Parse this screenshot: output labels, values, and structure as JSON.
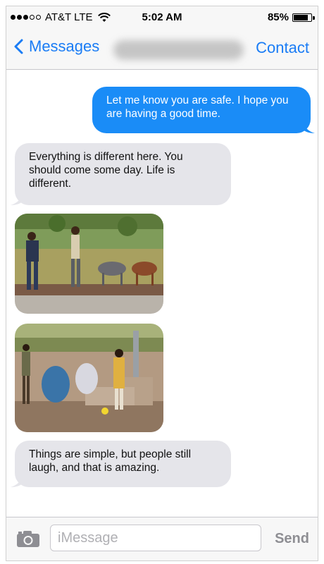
{
  "status_bar": {
    "carrier": "AT&T LTE",
    "time": "5:02 AM",
    "battery_text": "85%",
    "battery_level": 0.85,
    "signal_bars_filled": 3,
    "signal_bars_total": 5
  },
  "nav": {
    "back_label": "Messages",
    "contact_label": "Contact"
  },
  "messages": [
    {
      "direction": "sent",
      "text": "Let me know you are safe. I hope you are having a good time."
    },
    {
      "direction": "received",
      "text": "Everything is different here. You should come some day. Life is different."
    },
    {
      "direction": "received",
      "type": "image",
      "icon": "photo-people-walking-with-cattle"
    },
    {
      "direction": "received",
      "type": "image",
      "icon": "photo-people-at-water-pump"
    },
    {
      "direction": "received",
      "text": "Things are simple, but people still laugh, and that is amazing."
    }
  ],
  "input": {
    "placeholder": "iMessage",
    "value": "",
    "send_label": "Send"
  },
  "colors": {
    "accent": "#1a7cf5",
    "sent_bubble": "#1a8cf7",
    "received_bubble": "#e5e5ea"
  }
}
